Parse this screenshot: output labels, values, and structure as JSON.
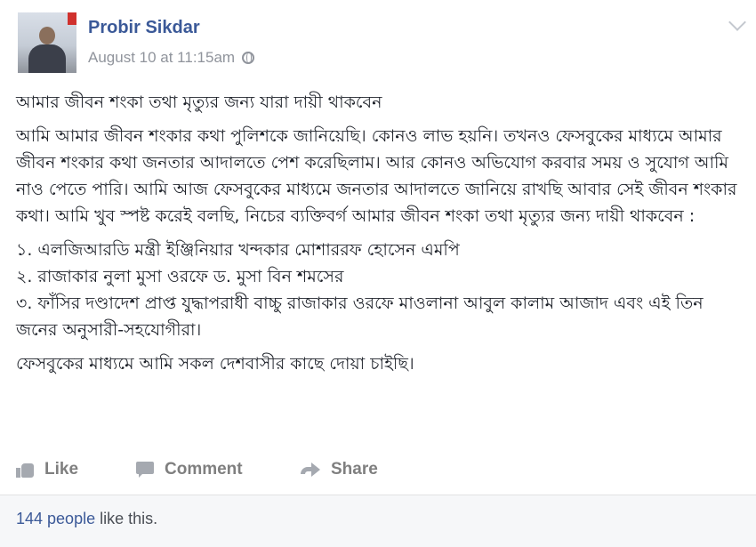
{
  "post": {
    "author": "Probir Sikdar",
    "timestamp": "August 10 at 11:15am",
    "privacy_icon": "globe-icon",
    "menu_icon": "chevron-down-icon",
    "heading": "আমার জীবন শংকা তথা মৃত্যুর জন্য যারা দায়ী থাকবেন",
    "paragraph": "আমি আমার জীবন শংকার কথা পুলিশকে জানিয়েছি। কোনও লাভ হয়নি। তখনও ফেসবুকের মাধ্যমে আমার জীবন শংকার কথা জনতার আদালতে পেশ করেছিলাম। আর কোনও অভিযোগ করবার সময় ও সুযোগ আমি নাও পেতে পারি। আমি আজ ফেসবুকের মাধ্যমে জনতার আদালতে জানিয়ে রাখছি আবার সেই জীবন শংকার কথা। আমি খুব স্পষ্ট করেই বলছি, নিচের ব্যক্তিবর্গ আমার জীবন শংকা তথা মৃত্যুর জন্য দায়ী থাকবেন :",
    "list": [
      "১. এলজিআরডি মন্ত্রী ইঞ্জিনিয়ার খন্দকার মোশাররফ হোসেন এমপি",
      "২. রাজাকার নুলা মুসা ওরফে ড. মুসা বিন শমসের",
      "৩. ফাঁসির দণ্ডাদেশ প্রাপ্ত যুদ্ধাপরাধী বাচ্চু রাজাকার ওরফে মাওলানা আবুল কালাম আজাদ এবং এই তিন জনের অনুসারী-সহযোগীরা।"
    ],
    "closing": "ফেসবুকের মাধ্যমে আমি সকল দেশবাসীর কাছে দোয়া চাইছি।"
  },
  "actions": {
    "like_label": "Like",
    "comment_label": "Comment",
    "share_label": "Share"
  },
  "footer": {
    "likes_count": "144 people",
    "likes_suffix": " like this."
  },
  "colors": {
    "author": "#3b5998",
    "muted": "#90949c",
    "action": "#7f7f7f",
    "footer_bg": "#f6f7f9"
  }
}
